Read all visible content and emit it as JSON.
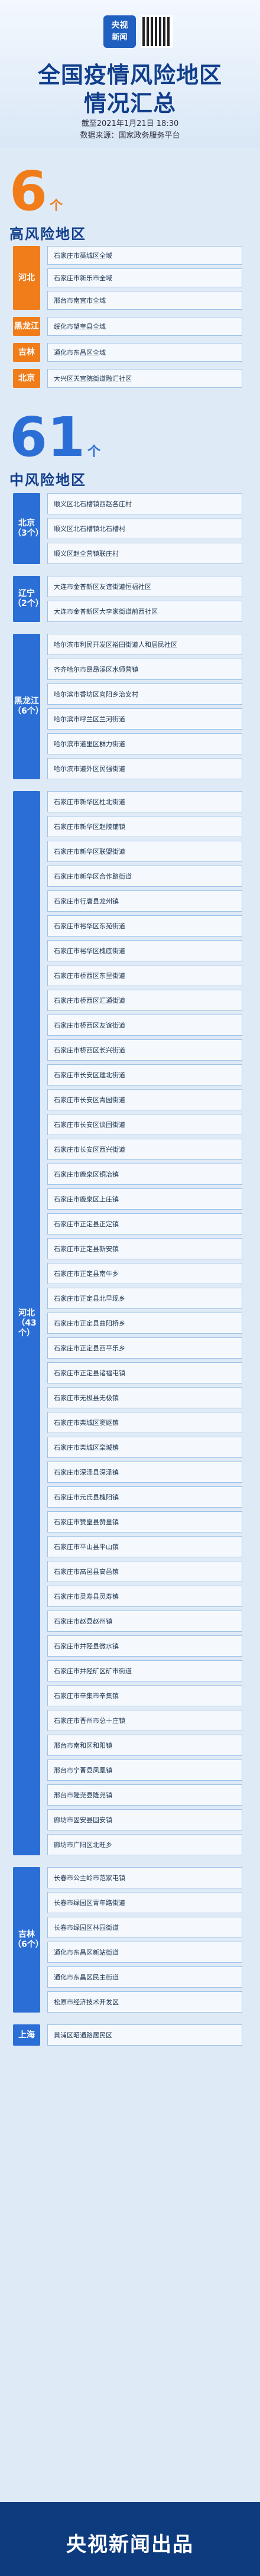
{
  "header": {
    "logo_top": "央视",
    "logo_bottom": "新闻",
    "title_line1": "全国疫情风险地区",
    "title_line2": "情况汇总",
    "deadline": "截至2021年1月21日 18:30",
    "source": "数据来源：国家政务服务平台"
  },
  "high": {
    "count": "6",
    "unit": "个",
    "title": "高风险地区",
    "color": "#f07d1a",
    "groups": [
      {
        "province": "河北",
        "items": [
          "石家庄市藁城区全域",
          "石家庄市新乐市全域",
          "邢台市南宫市全域"
        ]
      },
      {
        "province": "黑龙江",
        "items": [
          "绥化市望奎县全域"
        ]
      },
      {
        "province": "吉林",
        "items": [
          "通化市东昌区全域"
        ]
      },
      {
        "province": "北京",
        "items": [
          "大兴区天宫院街道融汇社区"
        ]
      }
    ]
  },
  "medium": {
    "count": "61",
    "unit": "个",
    "title": "中风险地区",
    "color": "#2b6fd6",
    "groups": [
      {
        "province": "北京（3个）",
        "items": [
          "顺义区北石槽镇西赵各庄村",
          "顺义区北石槽镇北石槽村",
          "顺义区赵全营镇联庄村"
        ]
      },
      {
        "province": "辽宁（2个）",
        "items": [
          "大连市金普新区友谊街道恒福社区",
          "大连市金普新区大李家街道前西社区"
        ]
      },
      {
        "province": "黑龙江（6个）",
        "items": [
          "哈尔滨市利民开发区裕田街道人和居民社区",
          "齐齐哈尔市昂昂溪区水师营镇",
          "哈尔滨市香坊区向阳乡治安村",
          "哈尔滨市呼兰区兰河街道",
          "哈尔滨市道里区群力街道",
          "哈尔滨市道外区民强街道"
        ]
      },
      {
        "province": "河北（43个）",
        "items": [
          "石家庄市新华区杜北街道",
          "石家庄市新华区赵陵铺镇",
          "石家庄市新华区联盟街道",
          "石家庄市新华区合作路街道",
          "石家庄市行唐县龙州镇",
          "石家庄市裕华区东苑街道",
          "石家庄市裕华区槐底街道",
          "石家庄市桥西区东里街道",
          "石家庄市桥西区汇通街道",
          "石家庄市桥西区友谊街道",
          "石家庄市桥西区长兴街道",
          "石家庄市长安区建北街道",
          "石家庄市长安区青园街道",
          "石家庄市长安区谈固街道",
          "石家庄市长安区西兴街道",
          "石家庄市鹿泉区铜冶镇",
          "石家庄市鹿泉区上庄镇",
          "石家庄市正定县正定镇",
          "石家庄市正定县新安镇",
          "石家庄市正定县南牛乡",
          "石家庄市正定县北早现乡",
          "石家庄市正定县曲阳桥乡",
          "石家庄市正定县西平乐乡",
          "石家庄市正定县诸福屯镇",
          "石家庄市无极县无极镇",
          "石家庄市栾城区窦妪镇",
          "石家庄市栾城区栾城镇",
          "石家庄市深泽县深泽镇",
          "石家庄市元氏县槐阳镇",
          "石家庄市赞皇县赞皇镇",
          "石家庄市平山县平山镇",
          "石家庄市高邑县高邑镇",
          "石家庄市灵寿县灵寿镇",
          "石家庄市赵县赵州镇",
          "石家庄市井陉县微水镇",
          "石家庄市井陉矿区矿市街道",
          "石家庄市辛集市辛集镇",
          "石家庄市晋州市总十庄镇",
          "邢台市南和区和阳镇",
          "邢台市宁晋县凤凰镇",
          "邢台市隆尧县隆尧镇",
          "廊坊市固安县固安镇",
          "廊坊市广阳区北旺乡"
        ]
      },
      {
        "province": "吉林（6个）",
        "items": [
          "长春市公主岭市范家屯镇",
          "长春市绿园区青年路街道",
          "长春市绿园区林园街道",
          "通化市东昌区新站街道",
          "通化市东昌区民主街道",
          "松原市经济技术开发区"
        ]
      },
      {
        "province": "上海",
        "items": [
          "黄浦区昭通路居民区"
        ]
      }
    ]
  },
  "footer": {
    "label": "央视新闻出品"
  }
}
